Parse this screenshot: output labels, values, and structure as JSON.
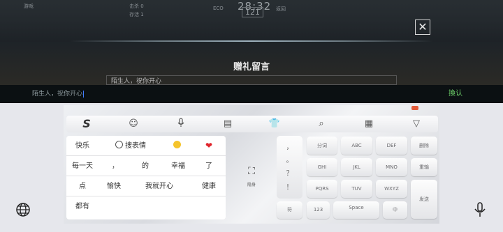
{
  "game": {
    "timer": "28:32",
    "sub_timer": "121",
    "close_icon": "close-icon",
    "hud_texts": [
      "游戏",
      "击杀 0",
      "存活 1",
      "ECO",
      "返回"
    ]
  },
  "dialog": {
    "title": "赠礼留言",
    "preview_text": "陌生人，祝你开心"
  },
  "input": {
    "value": "陌生人，祝你开心",
    "send_label": "換认"
  },
  "toolbar": {
    "icons": [
      "sogou-logo-icon",
      "emoji-icon",
      "voice-icon",
      "keyboard-icon",
      "skin-icon",
      "search-icon",
      "layout-icon",
      "collapse-icon"
    ]
  },
  "suggestions": {
    "row1": [
      "快乐",
      "搜表情",
      "grin-emoji",
      "heart-emoji"
    ],
    "row2": [
      "每一天",
      "，",
      "的",
      "幸福",
      "了"
    ],
    "row3": [
      "点",
      "愉快",
      "我就开心",
      "健康"
    ],
    "row4": [
      "都有"
    ]
  },
  "keyboard": {
    "ghost_label": "隐身",
    "punct": [
      "，",
      "。",
      "？",
      "！"
    ],
    "row1": [
      "分词",
      "ABC",
      "DEF",
      "删除"
    ],
    "row2": [
      "GHI",
      "JKL",
      "MNO",
      "重输"
    ],
    "row3": [
      "PQRS",
      "TUV",
      "WXYZ",
      "发送"
    ],
    "bottom": [
      "符",
      "123",
      "Space",
      "中"
    ]
  },
  "colors": {
    "send_green": "#6fd36b",
    "caret_blue": "#3e7bff",
    "heart_red": "#e0242c"
  }
}
